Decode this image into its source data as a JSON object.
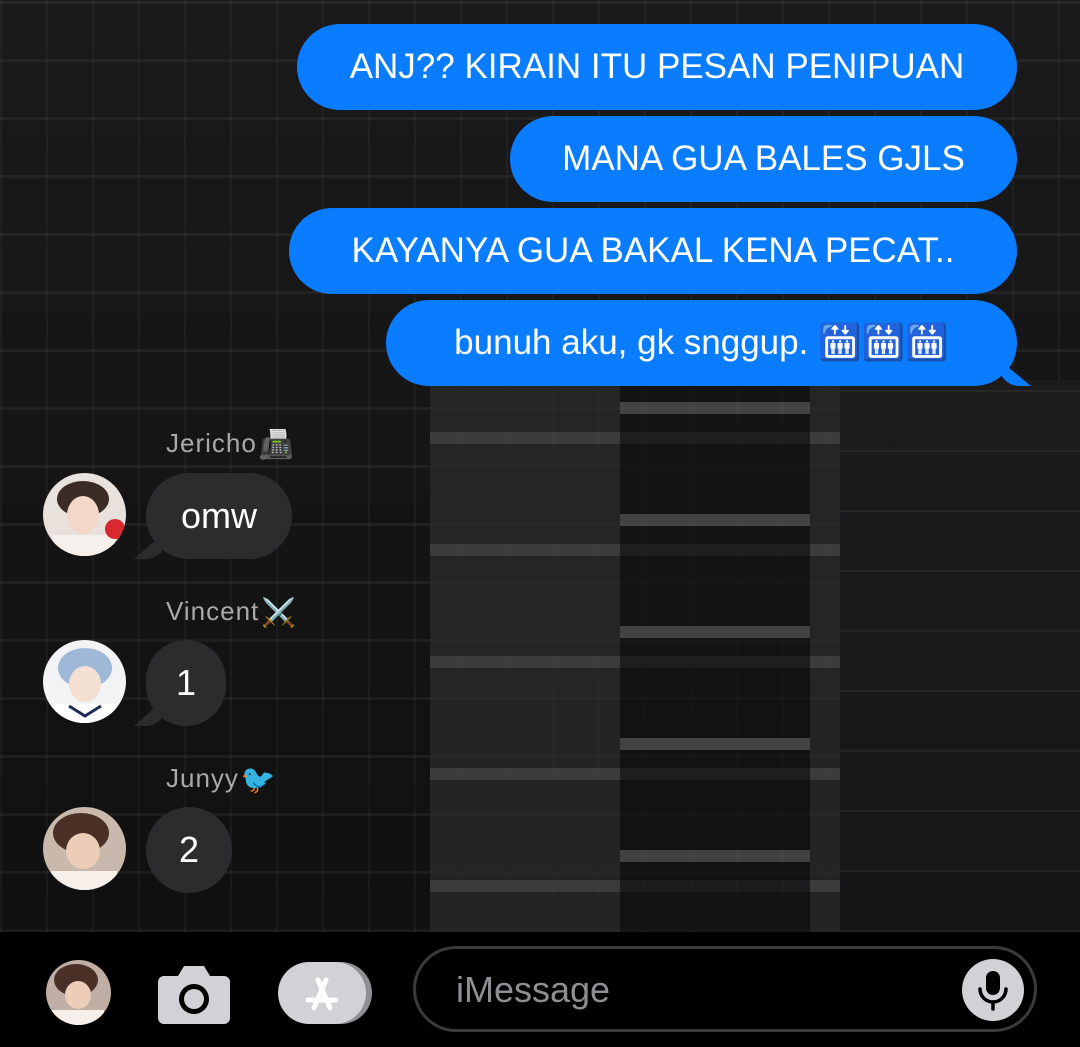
{
  "outgoing": [
    {
      "text": "ANJ?? KIRAIN ITU PESAN PENIPUAN"
    },
    {
      "text": "MANA GUA BALES GJLS"
    },
    {
      "text": "KAYANYA GUA BAKAL KENA PECAT.."
    },
    {
      "text": "bunuh aku, gk snggup. 🛗🛗🛗"
    }
  ],
  "incoming": [
    {
      "sender": "Jericho",
      "sender_emoji": "📠",
      "text": "omw"
    },
    {
      "sender": "Vincent",
      "sender_emoji": "⚔️",
      "text": "1"
    },
    {
      "sender": "Junyy",
      "sender_emoji": "🐦",
      "text": "2"
    }
  ],
  "composer": {
    "placeholder": "iMessage"
  },
  "icons": {
    "camera": "camera-icon",
    "app_store": "app-store-icon",
    "microphone": "microphone-icon"
  },
  "colors": {
    "outgoing_bubble": "#0a7cff",
    "incoming_bubble": "#2c2c2e",
    "bar_background": "#000000"
  }
}
